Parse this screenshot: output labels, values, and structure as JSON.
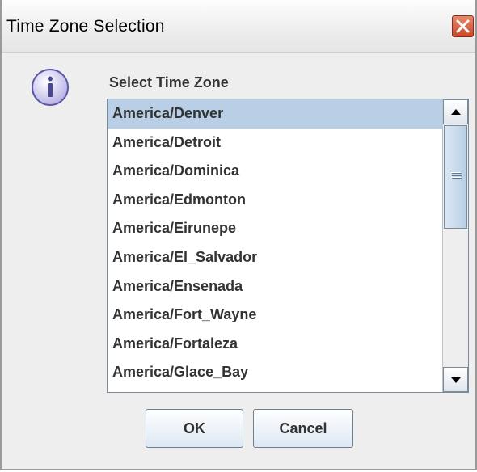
{
  "window": {
    "title": "Time Zone Selection"
  },
  "icons": {
    "info": "info-icon",
    "close": "close-icon"
  },
  "prompt": {
    "label": "Select Time Zone"
  },
  "list": {
    "selected_value": "America/Denver",
    "items": [
      {
        "label": "America/Denver",
        "selected": true
      },
      {
        "label": "America/Detroit",
        "selected": false
      },
      {
        "label": "America/Dominica",
        "selected": false
      },
      {
        "label": "America/Edmonton",
        "selected": false
      },
      {
        "label": "America/Eirunepe",
        "selected": false
      },
      {
        "label": "America/El_Salvador",
        "selected": false
      },
      {
        "label": "America/Ensenada",
        "selected": false
      },
      {
        "label": "America/Fort_Wayne",
        "selected": false
      },
      {
        "label": "America/Fortaleza",
        "selected": false
      },
      {
        "label": "America/Glace_Bay",
        "selected": false
      }
    ]
  },
  "buttons": {
    "ok_label": "OK",
    "cancel_label": "Cancel"
  },
  "colors": {
    "selection": "#b8cfe5",
    "close_button": "#c94a2a",
    "text": "#333333"
  }
}
